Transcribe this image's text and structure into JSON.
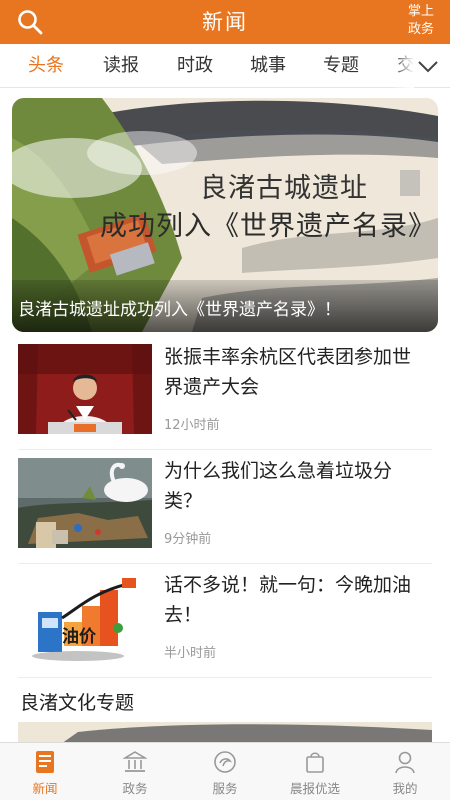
{
  "header": {
    "title": "新闻",
    "search_icon": "search-icon",
    "right_label": "掌上政务",
    "bg_color": "#e8751f"
  },
  "tabs": [
    {
      "label": "头条",
      "active": true
    },
    {
      "label": "读报",
      "active": false
    },
    {
      "label": "时政",
      "active": false
    },
    {
      "label": "城事",
      "active": false
    },
    {
      "label": "专题",
      "active": false
    },
    {
      "label": "交",
      "active": false
    }
  ],
  "tabs_more_icon": "chevron-down-icon",
  "banner": {
    "image_text_line1": "良渚古城遗址",
    "image_text_line2": "成功列入《世界遗产名录》",
    "caption": "良渚古城遗址成功列入《世界遗产名录》！"
  },
  "news": [
    {
      "headline": "张振丰率余杭区代表团参加世界遗产大会",
      "time": "12小时前",
      "thumb": "official-speaking-photo"
    },
    {
      "headline": "为什么我们这么急着垃圾分类？",
      "time": "9分钟前",
      "thumb": "swan-in-trash-photo"
    },
    {
      "headline": "话不多说！就一句：今晚加油去！",
      "time": "半小时前",
      "thumb": "fuel-price-graphic",
      "thumb_text": "油价"
    }
  ],
  "section": {
    "title": "良渚文化专题"
  },
  "bottom_nav": [
    {
      "label": "新闻",
      "icon": "newspaper-icon",
      "active": true
    },
    {
      "label": "政务",
      "icon": "government-building-icon",
      "active": false
    },
    {
      "label": "服务",
      "icon": "service-icon",
      "active": false
    },
    {
      "label": "晨报优选",
      "icon": "shopping-bag-icon",
      "active": false
    },
    {
      "label": "我的",
      "icon": "user-icon",
      "active": false
    }
  ]
}
